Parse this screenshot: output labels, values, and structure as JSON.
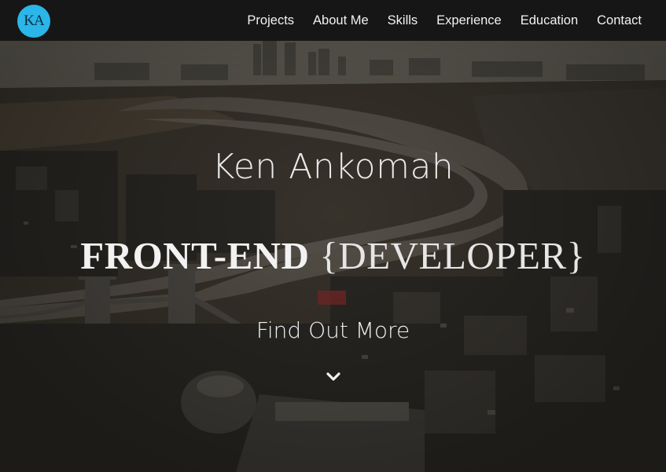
{
  "logo": {
    "text": "KA"
  },
  "nav": {
    "items": [
      {
        "label": "Projects"
      },
      {
        "label": "About Me"
      },
      {
        "label": "Skills"
      },
      {
        "label": "Experience"
      },
      {
        "label": "Education"
      },
      {
        "label": "Contact"
      }
    ]
  },
  "hero": {
    "name": "Ken Ankomah",
    "role_strong": "FRONT-END",
    "role_light": "{DEVELOPER}",
    "cta": "Find Out More",
    "cta_icon": "chevron-down-icon"
  },
  "colors": {
    "navbar": "#161616",
    "logo_bg": "#2ab6e8",
    "text": "#f2f2f2"
  }
}
